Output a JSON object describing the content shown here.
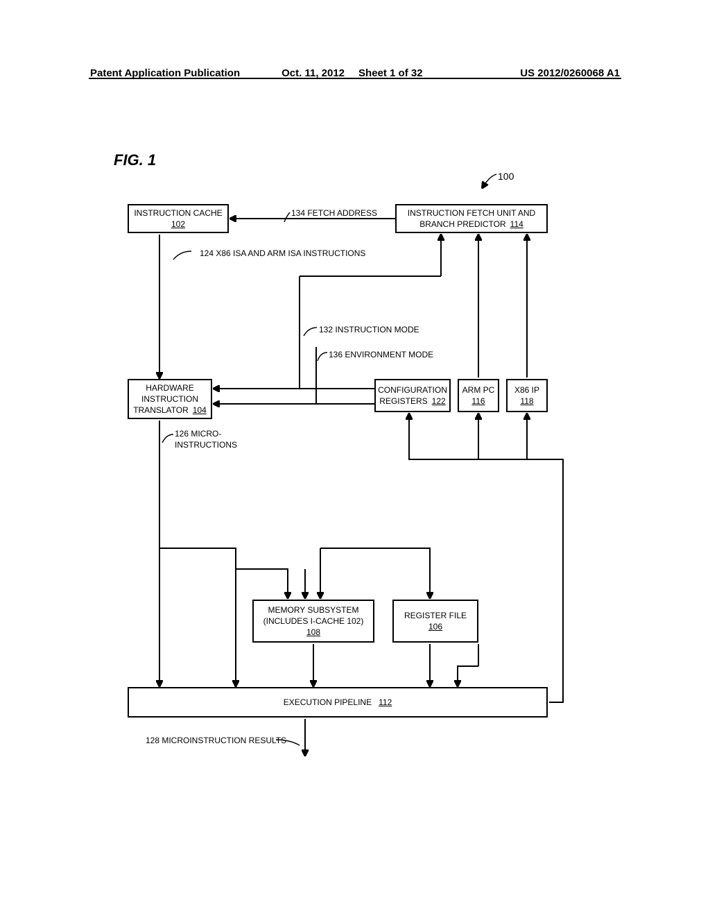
{
  "header": {
    "publication": "Patent Application Publication",
    "date": "Oct. 11, 2012",
    "sheet": "Sheet 1 of 32",
    "docnum": "US 2012/0260068 A1"
  },
  "figure_label": "FIG. 1",
  "ref100": "100",
  "boxes": {
    "icache": {
      "line1": "INSTRUCTION CACHE",
      "ref": "102"
    },
    "ifu": {
      "line1": "INSTRUCTION FETCH UNIT AND",
      "line2": "BRANCH PREDICTOR",
      "ref": "114"
    },
    "hit": {
      "line1": "HARDWARE",
      "line2": "INSTRUCTION",
      "line3": "TRANSLATOR",
      "ref": "104"
    },
    "cfg": {
      "line1": "CONFIGURATION",
      "line2": "REGISTERS",
      "ref": "122"
    },
    "armpc": {
      "line1": "ARM PC",
      "ref": "116"
    },
    "x86ip": {
      "line1": "X86 IP",
      "ref": "118"
    },
    "mem": {
      "line1": "MEMORY SUBSYSTEM",
      "line2": "(INCLUDES I-CACHE 102)",
      "ref": "108"
    },
    "regfile": {
      "line1": "REGISTER FILE",
      "ref": "106"
    },
    "exec": {
      "line1": "EXECUTION PIPELINE",
      "ref": "112"
    }
  },
  "labels": {
    "fetch_addr": "134 FETCH ADDRESS",
    "isa_instr": "124 X86 ISA AND ARM ISA INSTRUCTIONS",
    "instr_mode": "132 INSTRUCTION MODE",
    "env_mode": "136 ENVIRONMENT MODE",
    "micro": "126 MICRO-\nINSTRUCTIONS",
    "micro_results": "128 MICROINSTRUCTION RESULTS"
  }
}
